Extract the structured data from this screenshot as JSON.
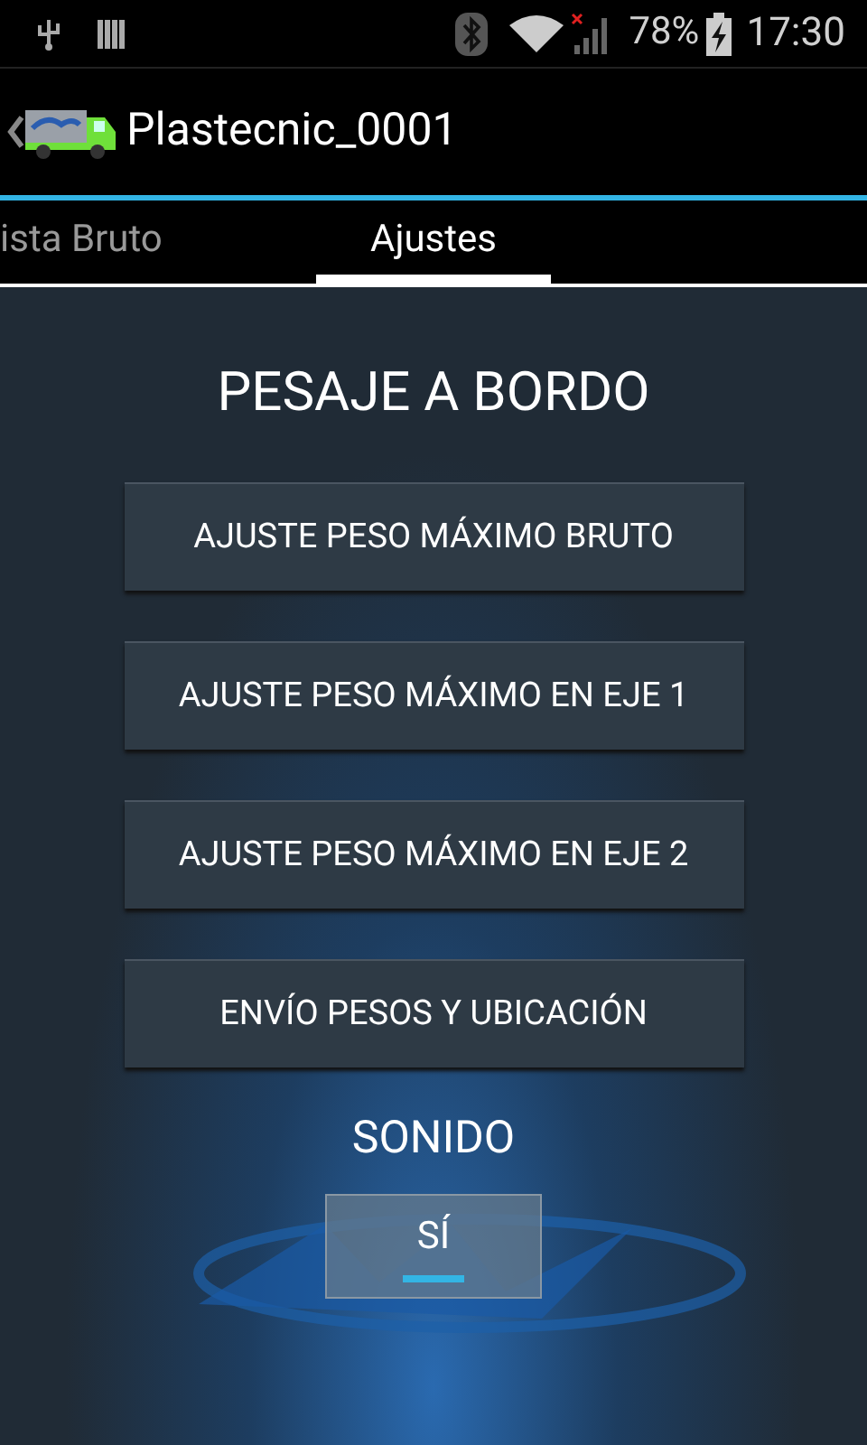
{
  "status_bar": {
    "battery": "78%",
    "time": "17:30"
  },
  "action_bar": {
    "title": "Plastecnic_0001"
  },
  "tabs": [
    {
      "label": "ista Bruto",
      "selected": false
    },
    {
      "label": "Ajustes",
      "selected": true
    }
  ],
  "section_title": "PESAJE A BORDO",
  "buttons": [
    "AJUSTE PESO MÁXIMO BRUTO",
    "AJUSTE PESO MÁXIMO EN EJE 1",
    "AJUSTE PESO MÁXIMO EN EJE 2",
    "ENVÍO PESOS Y UBICACIÓN"
  ],
  "sound": {
    "label": "SONIDO",
    "toggle": {
      "text": "SÍ",
      "on": true
    }
  }
}
